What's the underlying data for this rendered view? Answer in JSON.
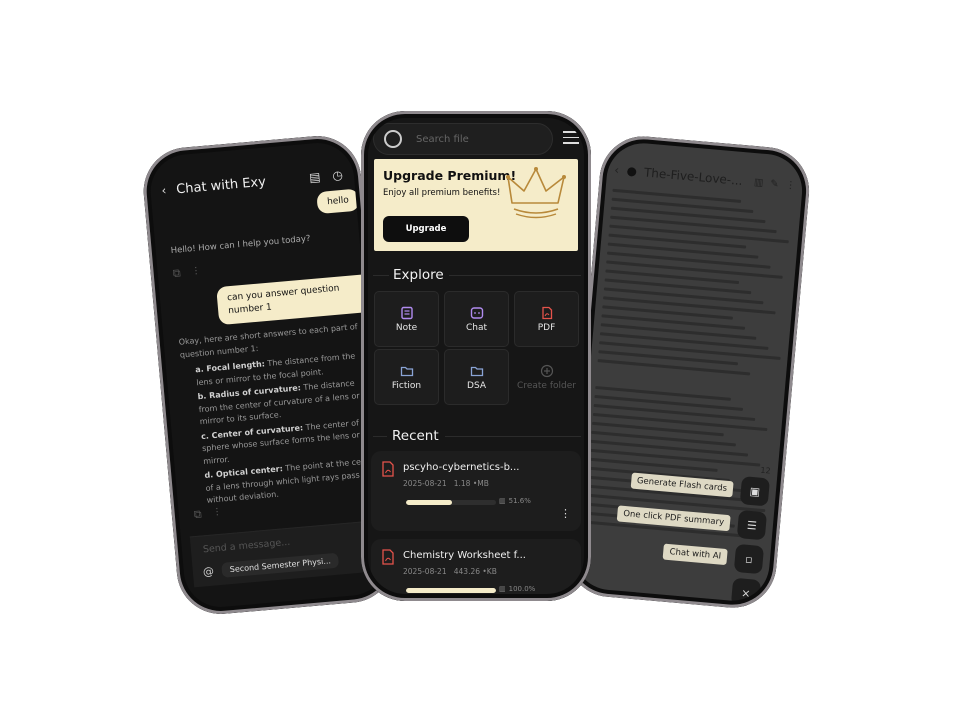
{
  "left": {
    "title": "Chat with Exy",
    "user_msg_1": "hello",
    "bot_msg_1": "Hello! How can I help you today?",
    "user_msg_2": "can you answer question number 1",
    "bot_intro": "Okay, here are short answers to each part of question number 1:",
    "answers": [
      {
        "term": "a. Focal length:",
        "text": "The distance from the lens or mirror to the focal point."
      },
      {
        "term": "b. Radius of curvature:",
        "text": "The distance from the center of curvature of a lens or mirror to its surface."
      },
      {
        "term": "c. Center of curvature:",
        "text": "The center of the sphere whose surface forms the lens or mirror."
      },
      {
        "term": "d. Optical center:",
        "text": "The point at the center of a lens through which light rays pass without deviation."
      }
    ],
    "send_placeholder": "Send a message...",
    "context_file": "Second Semester Physi..."
  },
  "center": {
    "search_placeholder": "Search file",
    "premium_title": "Upgrade Premium!",
    "premium_sub": "Enjoy all premium benefits!",
    "upgrade_label": "Upgrade",
    "explore_title": "Explore",
    "tiles": [
      "Note",
      "Chat",
      "PDF",
      "Fiction",
      "DSA",
      "Create folder"
    ],
    "recent_title": "Recent",
    "recent": [
      {
        "name": "pscyho-cybernetics-b...",
        "date": "2025-08-21",
        "size": "1.18 •MB",
        "pct": "51.6%",
        "progress": 0.516
      },
      {
        "name": "Chemistry Worksheet f...",
        "date": "2025-08-21",
        "size": "443.26 •KB",
        "pct": "100.0%",
        "progress": 1.0
      }
    ]
  },
  "right": {
    "doc_title": "The-Five-Love-...",
    "page_number": "12",
    "actions": [
      "Generate Flash cards",
      "One click PDF summary",
      "Chat with AI"
    ],
    "close_symbol": "×"
  },
  "colors": {
    "accent": "#f5ecc9",
    "background": "#161616",
    "pdf_red": "#e5534b",
    "note_purple": "#b18cf0"
  }
}
